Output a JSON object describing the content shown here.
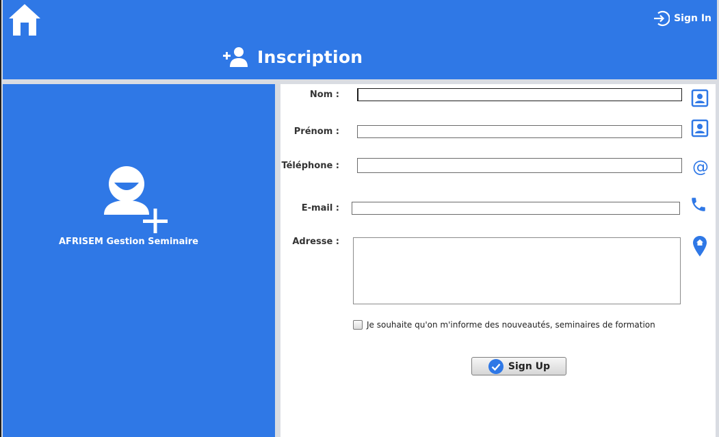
{
  "header": {
    "home_icon": "home-icon",
    "signin_label": "Sign In",
    "signin_icon": "sign-in-icon",
    "title": "Inscription",
    "title_icon": "add-user-icon",
    "color": "#2f78e6"
  },
  "left_panel": {
    "icon": "add-user-icon",
    "app_name": "AFRISEM Gestion Seminaire"
  },
  "form": {
    "fields": [
      {
        "label": "Nom :",
        "value": "",
        "icon": "contact-card-icon"
      },
      {
        "label": "Prénom :",
        "value": "",
        "icon": "contact-card-icon"
      },
      {
        "label": "Téléphone :",
        "value": "",
        "icon": "at-sign-icon"
      },
      {
        "label": "E-mail :",
        "value": "",
        "icon": "phone-icon"
      },
      {
        "label": "Adresse :",
        "value": "",
        "icon": "location-home-icon"
      }
    ],
    "newsletter_label": "Je souhaite qu'on m'informe des nouveautés, seminaires de formation",
    "newsletter_checked": false,
    "submit_label": "Sign Up",
    "submit_icon": "check-circle-icon"
  }
}
